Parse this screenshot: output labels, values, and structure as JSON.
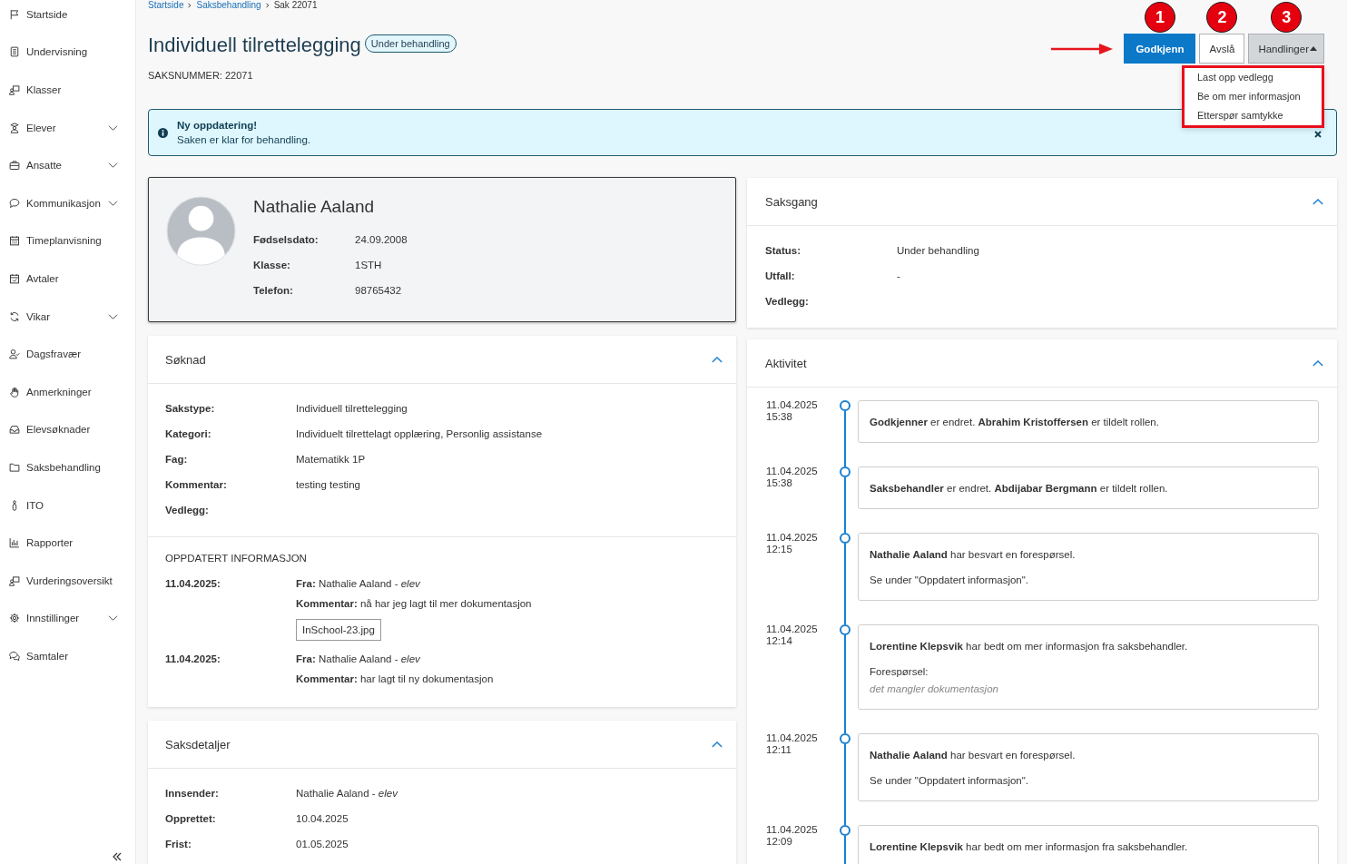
{
  "sidebar": {
    "items": [
      {
        "label": "Startside",
        "has_submenu": false
      },
      {
        "label": "Undervisning",
        "has_submenu": false
      },
      {
        "label": "Klasser",
        "has_submenu": false
      },
      {
        "label": "Elever",
        "has_submenu": true
      },
      {
        "label": "Ansatte",
        "has_submenu": true
      },
      {
        "label": "Kommunikasjon",
        "has_submenu": true
      },
      {
        "label": "Timeplanvisning",
        "has_submenu": false
      },
      {
        "label": "Avtaler",
        "has_submenu": false
      },
      {
        "label": "Vikar",
        "has_submenu": true
      },
      {
        "label": "Dagsfravær",
        "has_submenu": false
      },
      {
        "label": "Anmerkninger",
        "has_submenu": false
      },
      {
        "label": "Elevsøknader",
        "has_submenu": false
      },
      {
        "label": "Saksbehandling",
        "has_submenu": false
      },
      {
        "label": "ITO",
        "has_submenu": false
      },
      {
        "label": "Rapporter",
        "has_submenu": false
      },
      {
        "label": "Vurderingsoversikt",
        "has_submenu": false
      },
      {
        "label": "Innstillinger",
        "has_submenu": true
      },
      {
        "label": "Samtaler",
        "has_submenu": false
      }
    ]
  },
  "breadcrumb": [
    {
      "label": "Startside",
      "link": true
    },
    {
      "label": "Saksbehandling",
      "link": true
    },
    {
      "label": "Sak 22071",
      "link": false
    }
  ],
  "header": {
    "title": "Individuell tilrettelegging",
    "status_badge": "Under behandling",
    "case_number": "SAKSNUMMER: 22071",
    "arrow_annotation": true
  },
  "actions": [
    {
      "label": "Godkjenn",
      "kind": "primary",
      "marker": "1"
    },
    {
      "label": "Avslå",
      "kind": "secondary",
      "marker": "2"
    }
  ],
  "actions_menu": {
    "label": "Handlinger",
    "marker": "3",
    "expanded": true,
    "highlighted": true,
    "items": [
      "Last opp vedlegg",
      "Be om mer informasjon",
      "Etterspør samtykke"
    ]
  },
  "alert": {
    "title": "Ny oppdatering!",
    "message": "Saken er klar for behandling."
  },
  "person": {
    "name": "Nathalie Aaland",
    "fields": [
      {
        "label": "Fødselsdato:",
        "value": "24.09.2008"
      },
      {
        "label": "Klasse:",
        "value": "1STH"
      },
      {
        "label": "Telefon:",
        "value": "98765432"
      }
    ]
  },
  "application": {
    "title": "Søknad",
    "expanded": true,
    "fields": [
      {
        "label": "Sakstype:",
        "value": "Individuell tilrettelegging"
      },
      {
        "label": "Kategori:",
        "value": "Individuelt tilrettelagt opplæring, Personlig assistanse"
      },
      {
        "label": "Fag:",
        "value": "Matematikk 1P"
      },
      {
        "label": "Kommentar:",
        "value": "testing testing"
      },
      {
        "label": "Vedlegg:"
      }
    ],
    "updates_title": "OPPDATERT INFORMASJON",
    "updates": [
      {
        "date": "11.04.2025:",
        "from": "**Fra:** Nathalie Aaland - *elev*",
        "comment": "**Kommentar:** nå har jeg lagt til mer dokumentasjon",
        "attachments": [
          "InSchool-23.jpg"
        ]
      },
      {
        "date": "11.04.2025:",
        "from": "**Fra:** Nathalie Aaland - *elev*",
        "comment": "**Kommentar:** har lagt til ny dokumentasjon"
      }
    ]
  },
  "details": {
    "title": "Saksdetaljer",
    "expanded": true,
    "fields": [
      {
        "label": "Innsender:",
        "value": "Nathalie Aaland - *elev*"
      },
      {
        "label": "Opprettet:",
        "value": "10.04.2025"
      },
      {
        "label": "Frist:",
        "value": "01.05.2025"
      }
    ]
  },
  "case_flow": {
    "title": "Saksgang",
    "expanded": true,
    "fields": [
      {
        "label": "Status:",
        "value": "Under behandling"
      },
      {
        "label": "Utfall:",
        "value": "-"
      },
      {
        "label": "Vedlegg:"
      }
    ]
  },
  "activity": {
    "title": "Aktivitet",
    "expanded": true,
    "items": [
      {
        "date": "11.04.2025",
        "time": "15:38",
        "text": "**Godkjenner** er endret. **Abrahim Kristoffersen** er tildelt rollen."
      },
      {
        "date": "11.04.2025",
        "time": "15:38",
        "text": "**Saksbehandler** er endret. **Abdijabar Bergmann** er tildelt rollen."
      },
      {
        "date": "11.04.2025",
        "time": "12:15",
        "text": "**Nathalie Aaland** har besvart en forespørsel.",
        "note": "Se under \"Oppdatert informasjon\"."
      },
      {
        "date": "11.04.2025",
        "time": "12:14",
        "text": "**Lorentine Klepsvik** har bedt om mer informasjon fra saksbehandler.",
        "request_label": "Forespørsel:",
        "request": "det mangler dokumentasjon"
      },
      {
        "date": "11.04.2025",
        "time": "12:11",
        "text": "**Nathalie Aaland** har besvart en forespørsel.",
        "note": "Se under \"Oppdatert informasjon\"."
      },
      {
        "date": "11.04.2025",
        "time": "12:09",
        "text": "**Lorentine Klepsvik** har bedt om mer informasjon fra saksbehandler."
      }
    ]
  }
}
